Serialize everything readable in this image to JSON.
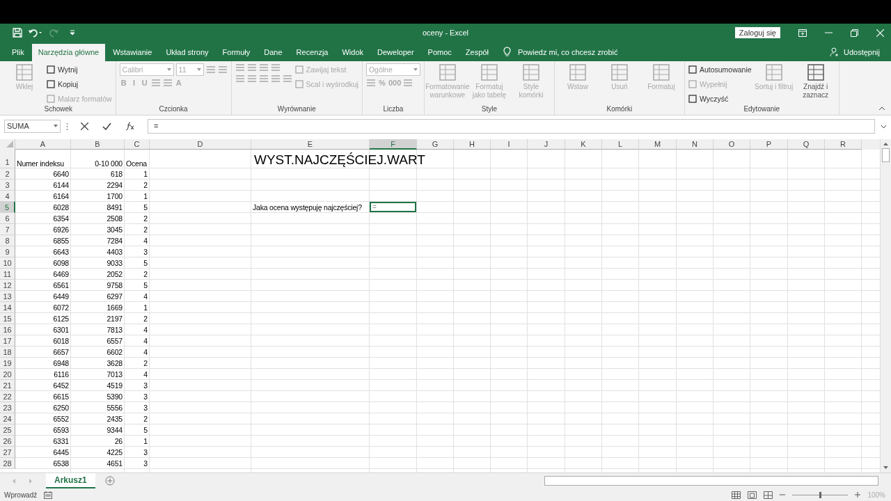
{
  "window": {
    "title": "oceny  -  Excel",
    "sign_in": "Zaloguj się"
  },
  "tabs": [
    {
      "label": "Plik",
      "selected": false
    },
    {
      "label": "Narzędzia główne",
      "selected": true
    },
    {
      "label": "Wstawianie",
      "selected": false
    },
    {
      "label": "Układ strony",
      "selected": false
    },
    {
      "label": "Formuły",
      "selected": false
    },
    {
      "label": "Dane",
      "selected": false
    },
    {
      "label": "Recenzja",
      "selected": false
    },
    {
      "label": "Widok",
      "selected": false
    },
    {
      "label": "Deweloper",
      "selected": false
    },
    {
      "label": "Pomoc",
      "selected": false
    },
    {
      "label": "Zespół",
      "selected": false
    }
  ],
  "tell_me": "Powiedz mi, co chcesz zrobić",
  "share": "Udostępnij",
  "ribbon": {
    "groups": [
      {
        "label": "Schowek",
        "columns": [
          [
            [
              {
                "kind": "large",
                "label": "Wklej",
                "disabled": true
              }
            ]
          ],
          [
            [
              {
                "kind": "small",
                "label": "Wytnij",
                "disabled": false
              }
            ],
            [
              {
                "kind": "small",
                "label": "Kopiuj",
                "disabled": false
              }
            ],
            [
              {
                "kind": "small",
                "label": "Malarz formatów",
                "disabled": true
              }
            ]
          ]
        ]
      },
      {
        "label": "Czcionka",
        "columns": [
          [
            [
              {
                "kind": "combo",
                "label": "Calibri",
                "disabled": true
              },
              {
                "kind": "size",
                "label": "11",
                "disabled": true
              },
              {
                "kind": "icon",
                "disabled": true
              },
              {
                "kind": "icon",
                "disabled": true
              }
            ],
            [
              {
                "kind": "toggle",
                "label": "B",
                "disabled": true
              },
              {
                "kind": "toggle",
                "label": "I",
                "disabled": true
              },
              {
                "kind": "toggle",
                "label": "U",
                "disabled": true
              },
              {
                "kind": "icon",
                "disabled": true
              },
              {
                "kind": "icon",
                "disabled": true
              },
              {
                "kind": "toggle",
                "label": "A",
                "disabled": true
              }
            ]
          ]
        ]
      },
      {
        "label": "Wyrównanie",
        "columns": [
          [
            [
              {
                "kind": "icon",
                "disabled": true
              },
              {
                "kind": "icon",
                "disabled": true
              },
              {
                "kind": "icon",
                "disabled": true
              },
              {
                "kind": "icon",
                "disabled": true
              }
            ],
            [
              {
                "kind": "icon",
                "disabled": true
              },
              {
                "kind": "icon",
                "disabled": true
              },
              {
                "kind": "icon",
                "disabled": true
              },
              {
                "kind": "icon",
                "disabled": true
              },
              {
                "kind": "icon",
                "disabled": true
              }
            ]
          ],
          [
            [
              {
                "kind": "small",
                "label": "Zawijaj tekst",
                "disabled": true
              }
            ],
            [
              {
                "kind": "small",
                "label": "Scal i wyśrodkuj",
                "disabled": true
              }
            ]
          ]
        ]
      },
      {
        "label": "Liczba",
        "columns": [
          [
            [
              {
                "kind": "combo",
                "label": "Ogólne",
                "disabled": true
              }
            ],
            [
              {
                "kind": "icon",
                "disabled": true
              },
              {
                "kind": "toggle",
                "label": "%",
                "disabled": true
              },
              {
                "kind": "toggle",
                "label": "000",
                "disabled": true
              },
              {
                "kind": "icon",
                "disabled": true
              }
            ]
          ]
        ]
      },
      {
        "label": "Style",
        "columns": [
          [
            [
              {
                "kind": "large",
                "label": "Formatowanie warunkowe",
                "disabled": true
              }
            ]
          ],
          [
            [
              {
                "kind": "large",
                "label": "Formatuj jako tabelę",
                "disabled": true
              }
            ]
          ],
          [
            [
              {
                "kind": "large",
                "label": "Style komórki",
                "disabled": true
              }
            ]
          ]
        ]
      },
      {
        "label": "Komórki",
        "columns": [
          [
            [
              {
                "kind": "large",
                "label": "Wstaw",
                "disabled": true
              }
            ]
          ],
          [
            [
              {
                "kind": "large",
                "label": "Usuń",
                "disabled": true
              }
            ]
          ],
          [
            [
              {
                "kind": "large",
                "label": "Formatuj",
                "disabled": true
              }
            ]
          ]
        ]
      },
      {
        "label": "Edytowanie",
        "columns": [
          [
            [
              {
                "kind": "small",
                "label": "Autosumowanie",
                "disabled": false
              }
            ],
            [
              {
                "kind": "small",
                "label": "Wypełnij",
                "disabled": true
              }
            ],
            [
              {
                "kind": "small",
                "label": "Wyczyść",
                "disabled": false
              }
            ]
          ],
          [
            [
              {
                "kind": "large",
                "label": "Sortuj i filtruj",
                "disabled": true
              }
            ]
          ],
          [
            [
              {
                "kind": "large",
                "label": "Znajdź i zaznacz",
                "disabled": false
              }
            ]
          ]
        ]
      }
    ]
  },
  "formula_bar": {
    "name_box": "SUMA",
    "formula": "="
  },
  "columns": [
    {
      "label": "A",
      "selected": false
    },
    {
      "label": "B",
      "selected": false
    },
    {
      "label": "C",
      "selected": false
    },
    {
      "label": "D",
      "selected": false
    },
    {
      "label": "E",
      "selected": false
    },
    {
      "label": "F",
      "selected": true
    },
    {
      "label": "G",
      "selected": false
    },
    {
      "label": "H",
      "selected": false
    },
    {
      "label": "I",
      "selected": false
    },
    {
      "label": "J",
      "selected": false
    },
    {
      "label": "K",
      "selected": false
    },
    {
      "label": "L",
      "selected": false
    },
    {
      "label": "M",
      "selected": false
    },
    {
      "label": "N",
      "selected": false
    },
    {
      "label": "O",
      "selected": false
    },
    {
      "label": "P",
      "selected": false
    },
    {
      "label": "Q",
      "selected": false
    },
    {
      "label": "R",
      "selected": false
    }
  ],
  "rows": [
    {
      "number": "1",
      "selected": false,
      "cells": [
        "Numer indeksu",
        "0-10 000",
        "Ocena"
      ],
      "e": "WYST.NAJCZĘŚCIEJ.WART"
    },
    {
      "number": "2",
      "selected": false,
      "cells": [
        "6640",
        "618",
        "1"
      ]
    },
    {
      "number": "3",
      "selected": false,
      "cells": [
        "6144",
        "2294",
        "2"
      ]
    },
    {
      "number": "4",
      "selected": false,
      "cells": [
        "6164",
        "1700",
        "1"
      ]
    },
    {
      "number": "5",
      "selected": true,
      "cells": [
        "6028",
        "8491",
        "5"
      ],
      "e": "Jaka ocena występuję najczęściej?",
      "f": "="
    },
    {
      "number": "6",
      "selected": false,
      "cells": [
        "6354",
        "2508",
        "2"
      ]
    },
    {
      "number": "7",
      "selected": false,
      "cells": [
        "6926",
        "3045",
        "2"
      ]
    },
    {
      "number": "8",
      "selected": false,
      "cells": [
        "6855",
        "7284",
        "4"
      ]
    },
    {
      "number": "9",
      "selected": false,
      "cells": [
        "6643",
        "4403",
        "3"
      ]
    },
    {
      "number": "10",
      "selected": false,
      "cells": [
        "6098",
        "9033",
        "5"
      ]
    },
    {
      "number": "11",
      "selected": false,
      "cells": [
        "6469",
        "2052",
        "2"
      ]
    },
    {
      "number": "12",
      "selected": false,
      "cells": [
        "6561",
        "9758",
        "5"
      ]
    },
    {
      "number": "13",
      "selected": false,
      "cells": [
        "6449",
        "6297",
        "4"
      ]
    },
    {
      "number": "14",
      "selected": false,
      "cells": [
        "6072",
        "1669",
        "1"
      ]
    },
    {
      "number": "15",
      "selected": false,
      "cells": [
        "6125",
        "2197",
        "2"
      ]
    },
    {
      "number": "16",
      "selected": false,
      "cells": [
        "6301",
        "7813",
        "4"
      ]
    },
    {
      "number": "17",
      "selected": false,
      "cells": [
        "6018",
        "6557",
        "4"
      ]
    },
    {
      "number": "18",
      "selected": false,
      "cells": [
        "6657",
        "6602",
        "4"
      ]
    },
    {
      "number": "19",
      "selected": false,
      "cells": [
        "6948",
        "3628",
        "2"
      ]
    },
    {
      "number": "20",
      "selected": false,
      "cells": [
        "6116",
        "7013",
        "4"
      ]
    },
    {
      "number": "21",
      "selected": false,
      "cells": [
        "6452",
        "4519",
        "3"
      ]
    },
    {
      "number": "22",
      "selected": false,
      "cells": [
        "6615",
        "5390",
        "3"
      ]
    },
    {
      "number": "23",
      "selected": false,
      "cells": [
        "6250",
        "5556",
        "3"
      ]
    },
    {
      "number": "24",
      "selected": false,
      "cells": [
        "6552",
        "2435",
        "2"
      ]
    },
    {
      "number": "25",
      "selected": false,
      "cells": [
        "6593",
        "9344",
        "5"
      ]
    },
    {
      "number": "26",
      "selected": false,
      "cells": [
        "6331",
        "26",
        "1"
      ]
    },
    {
      "number": "27",
      "selected": false,
      "cells": [
        "6445",
        "4225",
        "3"
      ]
    },
    {
      "number": "28",
      "selected": false,
      "cells": [
        "6538",
        "4651",
        "3"
      ]
    }
  ],
  "sheets": [
    {
      "label": "Arkusz1",
      "selected": true
    }
  ],
  "status_bar": {
    "mode": "Wprowadź",
    "zoom": "100%",
    "zoom_slider": {
      "level": 0.5
    }
  }
}
